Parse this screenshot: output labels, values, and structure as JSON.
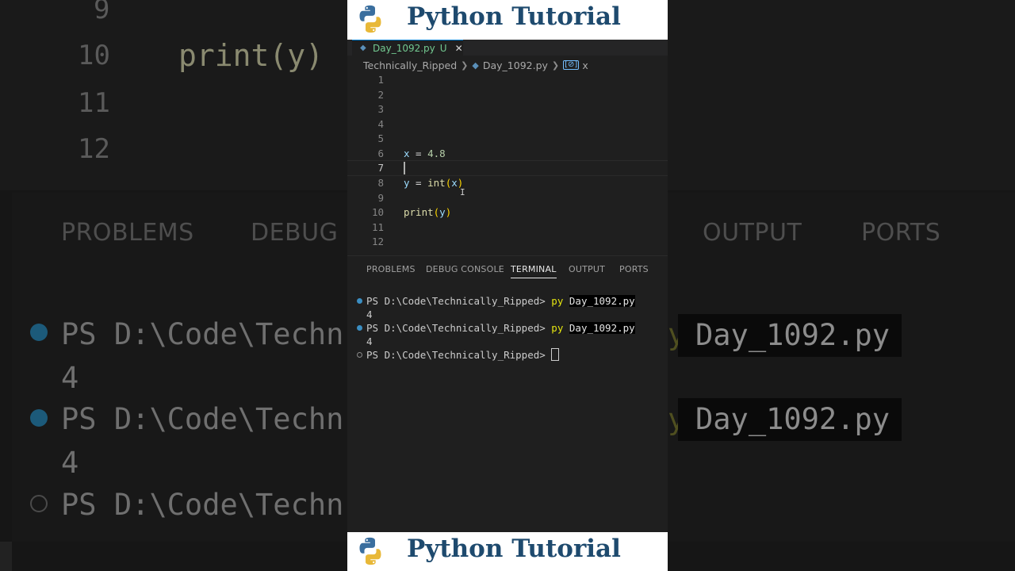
{
  "banner": {
    "title": "Python Tutorial"
  },
  "editor": {
    "tab": {
      "filename": "Day_1092.py",
      "status": "U",
      "close": "✕"
    },
    "breadcrumb": {
      "folder": "Technically_Ripped",
      "file": "Day_1092.py",
      "symbol": "x"
    },
    "lines": [
      {
        "num": "1"
      },
      {
        "num": "2"
      },
      {
        "num": "3"
      },
      {
        "num": "4"
      },
      {
        "num": "5"
      },
      {
        "num": "6",
        "code": [
          "x",
          " = ",
          "4.8"
        ]
      },
      {
        "num": "7"
      },
      {
        "num": "8",
        "code": [
          "y",
          " = ",
          "int",
          "(",
          "x",
          ")"
        ]
      },
      {
        "num": "9"
      },
      {
        "num": "10",
        "code": [
          "print",
          "(",
          "y",
          ")"
        ]
      },
      {
        "num": "11"
      },
      {
        "num": "12"
      }
    ]
  },
  "panel": {
    "tabs": [
      "PROBLEMS",
      "DEBUG CONSOLE",
      "TERMINAL",
      "OUTPUT",
      "PORTS"
    ],
    "active_tab": "TERMINAL"
  },
  "terminal": {
    "prompt": "PS D:\\Code\\Technically_Ripped> ",
    "command": "py",
    "argument": "Day_1092.py",
    "output": "4"
  },
  "background": {
    "line_numbers": [
      "9",
      "10",
      "11",
      "12"
    ],
    "code": "print(y)",
    "tabs": [
      "PROBLEMS",
      "DEBUG C",
      "OUTPUT",
      "PORTS"
    ],
    "terminal_prompt": "PS D:\\Code\\Techn",
    "terminal_output": "4",
    "file": "Day_1092.py",
    "file_prefix": "y"
  },
  "colors": {
    "accent_blue": "#007acc",
    "untracked_green": "#73c991",
    "banner_text": "#1e4a6e"
  }
}
